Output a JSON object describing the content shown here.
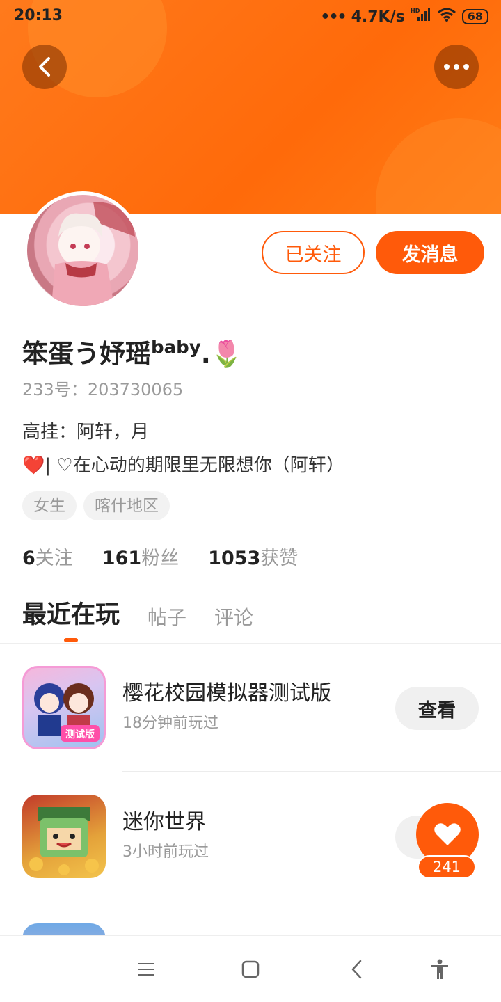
{
  "status_bar": {
    "time": "20:13",
    "network_speed": "4.7K/s",
    "network_type": "HD",
    "battery": "68"
  },
  "header": {
    "back_icon": "chevron-left-icon",
    "more_icon": "more-horizontal-icon",
    "accent_color": "#ff6a0a"
  },
  "profile": {
    "username": "笨蛋う妤瑶",
    "username_suffix": "baby",
    "username_emoji": ".🌷",
    "uid_label": "233号：",
    "uid": "203730065",
    "bio_line1": "高挂：阿轩，月",
    "bio_line2": "❤️| ♡在心动的期限里无限想你（阿轩）",
    "tags": [
      "女生",
      "喀什地区"
    ]
  },
  "actions": {
    "follow_label": "已关注",
    "message_label": "发消息"
  },
  "stats": [
    {
      "value": "6",
      "label": "关注"
    },
    {
      "value": "161",
      "label": "粉丝"
    },
    {
      "value": "1053",
      "label": "获赞"
    }
  ],
  "tabs": [
    "最近在玩",
    "帖子",
    "评论"
  ],
  "games": [
    {
      "name": "樱花校园模拟器测试版",
      "time": "18分钟前玩过",
      "button": "查看",
      "badge": "测试版"
    },
    {
      "name": "迷你世界",
      "time": "3小时前玩过",
      "button": "查看"
    }
  ],
  "fab": {
    "icon": "heart-icon",
    "count": "241"
  },
  "nav_bar": {
    "items": [
      "menu-icon",
      "home-square-icon",
      "back-icon",
      "accessibility-icon"
    ]
  }
}
